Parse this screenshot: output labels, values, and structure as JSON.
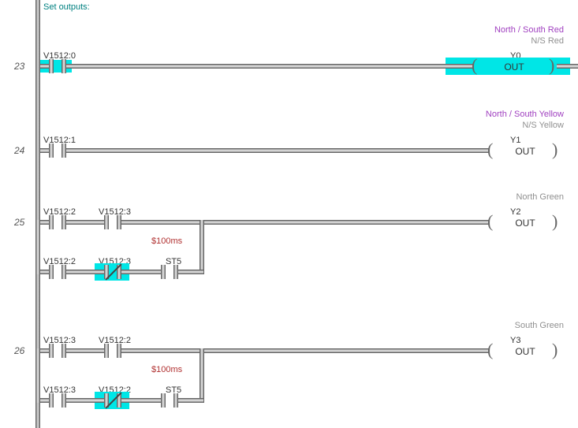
{
  "comment_title": "Set outputs:",
  "rungs": {
    "23": {
      "num": "23",
      "contact_addr": "V1512:0",
      "coil": {
        "descr": "North / South Red",
        "nickname": "N/S Red",
        "addr": "Y0",
        "text": "OUT"
      }
    },
    "24": {
      "num": "24",
      "contact_addr": "V1512:1",
      "coil": {
        "descr": "North / South Yellow",
        "nickname": "N/S Yellow",
        "addr": "Y1",
        "text": "OUT"
      }
    },
    "25": {
      "num": "25",
      "contact_a": "V1512:2",
      "contact_b": "V1512:3",
      "branch": {
        "c1": "V1512:2",
        "c2": "V1512:3",
        "c3": "ST5"
      },
      "timer": "$100ms",
      "coil": {
        "nickname": "North Green",
        "addr": "Y2",
        "text": "OUT"
      }
    },
    "26": {
      "num": "26",
      "contact_a": "V1512:3",
      "contact_b": "V1512:2",
      "branch": {
        "c1": "V1512:3",
        "c2": "V1512:2",
        "c3": "ST5"
      },
      "timer": "$100ms",
      "coil": {
        "nickname": "South Green",
        "addr": "Y3",
        "text": "OUT"
      }
    }
  }
}
